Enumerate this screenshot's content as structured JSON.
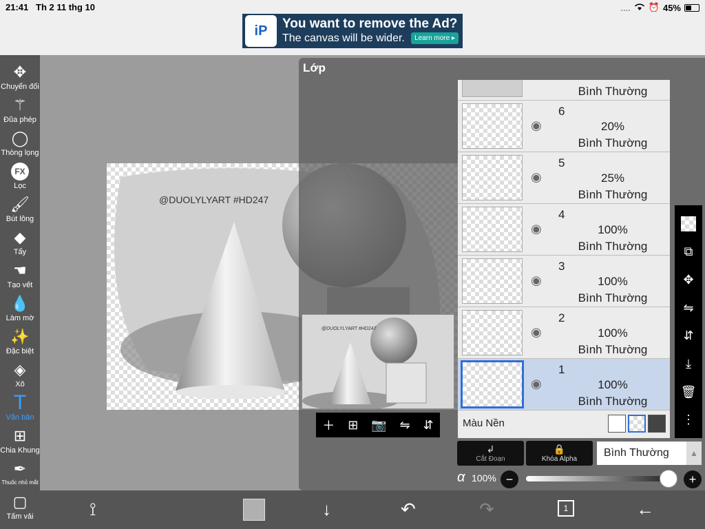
{
  "status": {
    "time": "21:41",
    "date": "Th 2 11 thg 10",
    "signal": "....",
    "battery": "45%"
  },
  "ad": {
    "title": "You want to remove the Ad?",
    "subtitle": "The canvas will be wider.",
    "button": "Learn more ▸",
    "logo": "iP"
  },
  "tools": [
    {
      "label": "Chuyển đổi",
      "icon": "move-icon"
    },
    {
      "label": "Đũa phép",
      "icon": "magic-wand-icon"
    },
    {
      "label": "Thòng lọng",
      "icon": "lasso-icon"
    },
    {
      "label": "Lọc",
      "icon": "fx-filter-icon",
      "glyph": "FX"
    },
    {
      "label": "Bút lông",
      "icon": "brush-icon"
    },
    {
      "label": "Tẩy",
      "icon": "eraser-icon"
    },
    {
      "label": "Tạo vết",
      "icon": "smudge-icon"
    },
    {
      "label": "Làm mờ",
      "icon": "blur-icon"
    },
    {
      "label": "Đặc biệt",
      "icon": "special-icon"
    },
    {
      "label": "Xô",
      "icon": "bucket-icon"
    },
    {
      "label": "Văn bản",
      "icon": "text-icon",
      "glyph": "T",
      "active": true
    },
    {
      "label": "Chia Khung",
      "icon": "frame-divide-icon"
    },
    {
      "label": "Thuốc nhỏ mắt",
      "icon": "eyedropper-icon"
    },
    {
      "label": "Tấm vải",
      "icon": "canvas-icon"
    }
  ],
  "canvas": {
    "watermark": "@DUOLYLYART #HD247"
  },
  "layer_panel": {
    "title": "Lớp",
    "partial_layer": {
      "mode": "Bình Thường"
    },
    "layers": [
      {
        "number": "6",
        "opacity": "20%",
        "mode": "Bình Thường"
      },
      {
        "number": "5",
        "opacity": "25%",
        "mode": "Bình Thường"
      },
      {
        "number": "4",
        "opacity": "100%",
        "mode": "Bình Thường"
      },
      {
        "number": "3",
        "opacity": "100%",
        "mode": "Bình Thường"
      },
      {
        "number": "2",
        "opacity": "100%",
        "mode": "Bình Thường"
      },
      {
        "number": "1",
        "opacity": "100%",
        "mode": "Bình Thường",
        "selected": true
      }
    ],
    "background_label": "Màu Nền",
    "thumb_watermark": "@DUOLYLYART #HD247"
  },
  "controls": {
    "clipping_label": "Cắt Đoạn",
    "alpha_lock_label": "Khóa Alpha",
    "blend_mode": "Bình Thường",
    "alpha_symbol": "α",
    "opacity_value": "100%",
    "opacity_level": 1.0
  },
  "bottom": {
    "layer_count": "1"
  },
  "colors": {
    "accent": "#3aa0ff",
    "selected_layer": "#c8d6ec",
    "selected_border": "#2f6fd8"
  }
}
